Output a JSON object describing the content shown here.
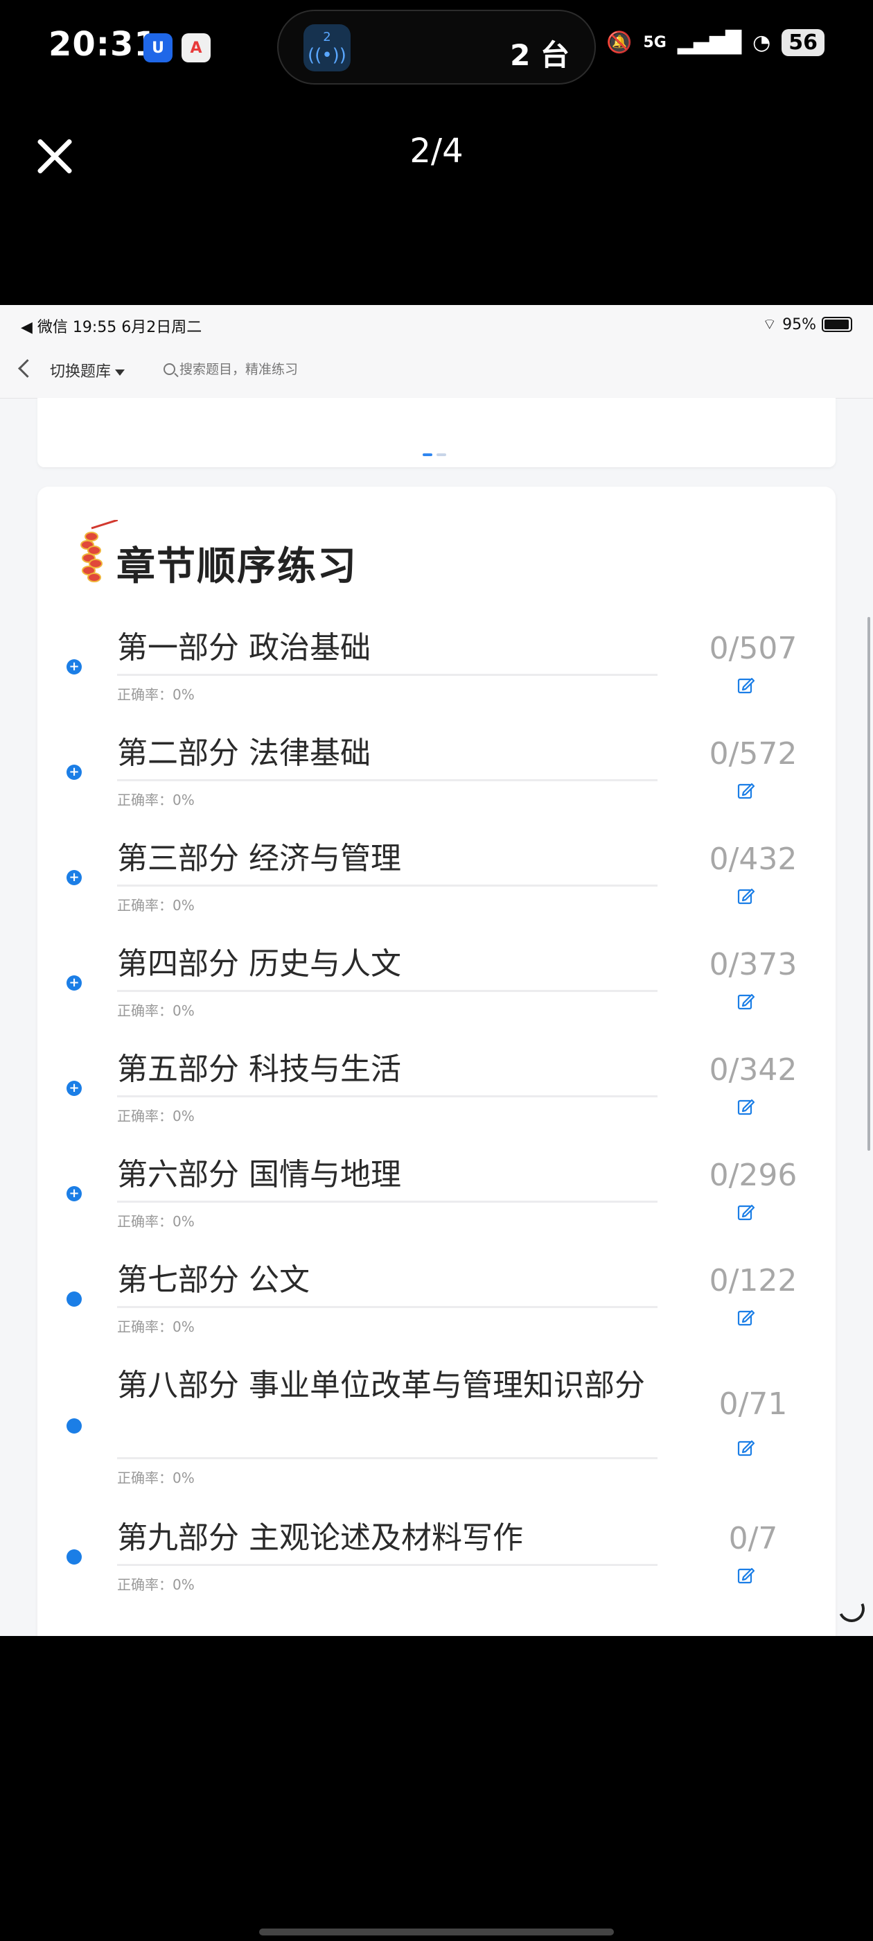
{
  "os_status": {
    "time": "20:31",
    "island_badge": "2",
    "island_text": "2 台",
    "network": "5G",
    "battery": "56"
  },
  "viewer": {
    "counter": "2/4"
  },
  "inner_status": {
    "left": "◀ 微信   19:55   6月2日周二",
    "battery": "95%"
  },
  "inner_nav": {
    "switch_label": "切换题库",
    "search_placeholder": "搜索题目，精准练习"
  },
  "section": {
    "title": "章节顺序练习"
  },
  "chapters": [
    {
      "title": "第一部分 政治基础",
      "accuracy": "正确率：0%",
      "count": "0/507",
      "bullet": "+"
    },
    {
      "title": "第二部分 法律基础",
      "accuracy": "正确率：0%",
      "count": "0/572",
      "bullet": "+"
    },
    {
      "title": "第三部分 经济与管理",
      "accuracy": "正确率：0%",
      "count": "0/432",
      "bullet": "+"
    },
    {
      "title": "第四部分 历史与人文",
      "accuracy": "正确率：0%",
      "count": "0/373",
      "bullet": "+"
    },
    {
      "title": "第五部分 科技与生活",
      "accuracy": "正确率：0%",
      "count": "0/342",
      "bullet": "+"
    },
    {
      "title": "第六部分 国情与地理",
      "accuracy": "正确率：0%",
      "count": "0/296",
      "bullet": "+"
    },
    {
      "title": "第七部分 公文",
      "accuracy": "正确率：0%",
      "count": "0/122",
      "bullet": ""
    },
    {
      "title": "第八部分 事业单位改革与管理知识部分",
      "accuracy": "正确率：0%",
      "count": "0/71",
      "bullet": ""
    },
    {
      "title": "第九部分 主观论述及材料写作",
      "accuracy": "正确率：0%",
      "count": "0/7",
      "bullet": ""
    }
  ],
  "colors": {
    "accent": "#1b7ee6",
    "count_text": "#a7a7a7"
  }
}
